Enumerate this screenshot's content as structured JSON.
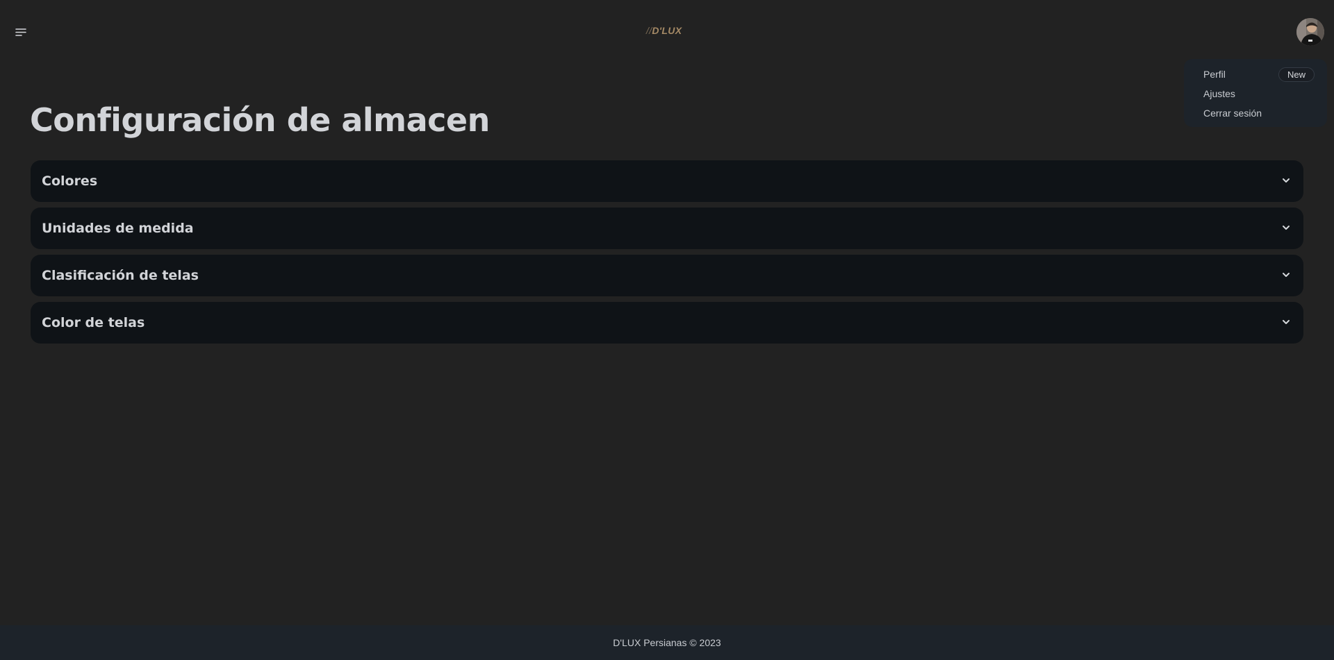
{
  "header": {
    "logo_text": "D'LUX",
    "logo_slashes": "//",
    "menu_icon": "hamburger-menu-icon",
    "avatar_icon": "user-avatar"
  },
  "user_menu": {
    "items": [
      {
        "label": "Perfil",
        "badge": "New"
      },
      {
        "label": "Ajustes"
      },
      {
        "label": "Cerrar sesión"
      }
    ]
  },
  "main": {
    "title": "Configuración de almacen",
    "accordions": [
      {
        "label": "Colores",
        "icon": "chevron-down-icon"
      },
      {
        "label": "Unidades de medida",
        "icon": "chevron-down-icon"
      },
      {
        "label": "Clasificación de telas",
        "icon": "chevron-down-icon"
      },
      {
        "label": "Color de telas",
        "icon": "chevron-down-icon"
      }
    ]
  },
  "footer": {
    "text": "D'LUX Persianas © 2023"
  },
  "colors": {
    "background": "#222222",
    "panel": "#0f1317",
    "footer": "#1d232a",
    "dropdown": "#1d232a",
    "logo": "#a58a66",
    "text": "#d2d4d8"
  }
}
